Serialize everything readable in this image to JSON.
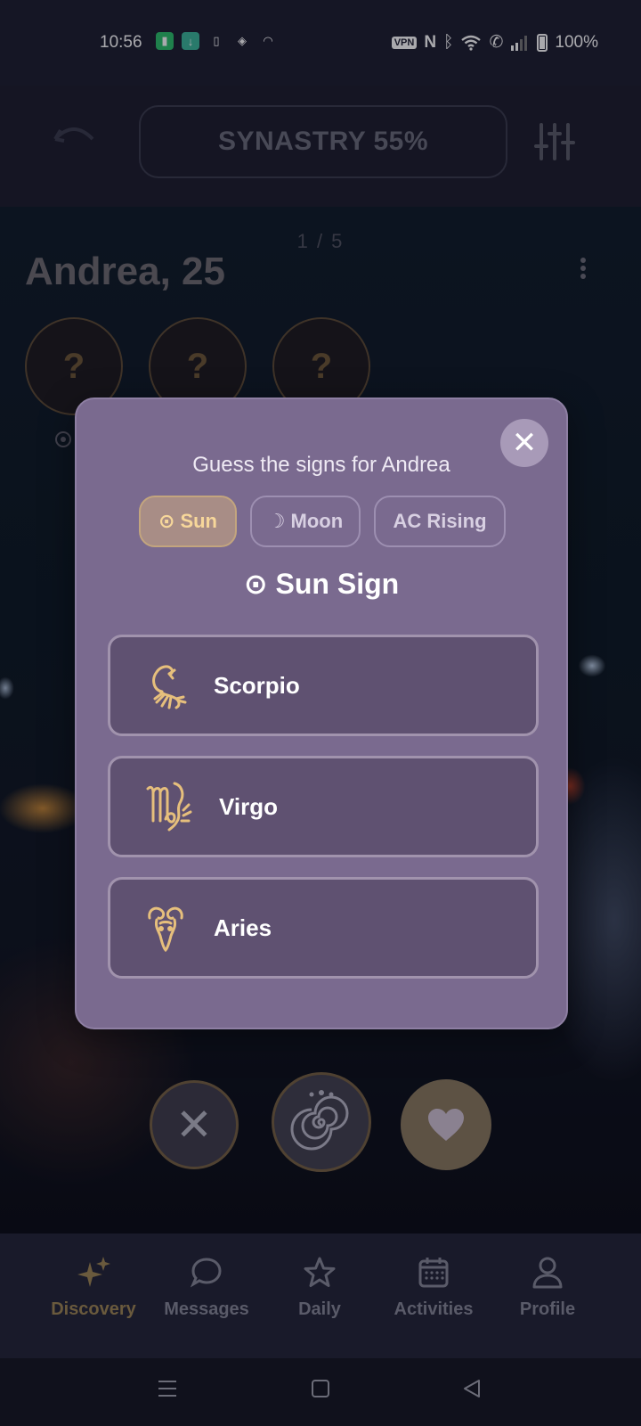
{
  "status_bar": {
    "time": "10:56",
    "vpn_label": "VPN",
    "battery": "100%"
  },
  "header": {
    "synastry_label": "SYNASTRY 55%"
  },
  "profile": {
    "photo_counter": "1 / 5",
    "name_age": "Andrea, 25",
    "sign_placeholders": [
      "?",
      "?",
      "?"
    ]
  },
  "modal": {
    "title": "Guess the signs for Andrea",
    "close_symbol": "✕",
    "tabs": [
      {
        "icon": "⊙",
        "label": "Sun",
        "active": true
      },
      {
        "icon": "☽",
        "label": "Moon",
        "active": false
      },
      {
        "icon": "",
        "label": "AC Rising",
        "active": false
      }
    ],
    "section_icon": "⊙",
    "section_title": "Sun Sign",
    "options": [
      {
        "label": "Scorpio",
        "icon": "scorpio-icon"
      },
      {
        "label": "Virgo",
        "icon": "virgo-icon"
      },
      {
        "label": "Aries",
        "icon": "aries-icon"
      }
    ]
  },
  "actions": {
    "pass_symbol": "✕"
  },
  "bottom_nav": {
    "items": [
      {
        "label": "Discovery",
        "icon": "sparkles-icon",
        "active": true
      },
      {
        "label": "Messages",
        "icon": "chat-icon",
        "active": false
      },
      {
        "label": "Daily",
        "icon": "star-icon",
        "active": false
      },
      {
        "label": "Activities",
        "icon": "calendar-icon",
        "active": false
      },
      {
        "label": "Profile",
        "icon": "person-icon",
        "active": false
      }
    ]
  },
  "colors": {
    "gold": "#e6bf7c",
    "modal_bg": "#7a6a8f",
    "option_bg": "#5f5171"
  }
}
